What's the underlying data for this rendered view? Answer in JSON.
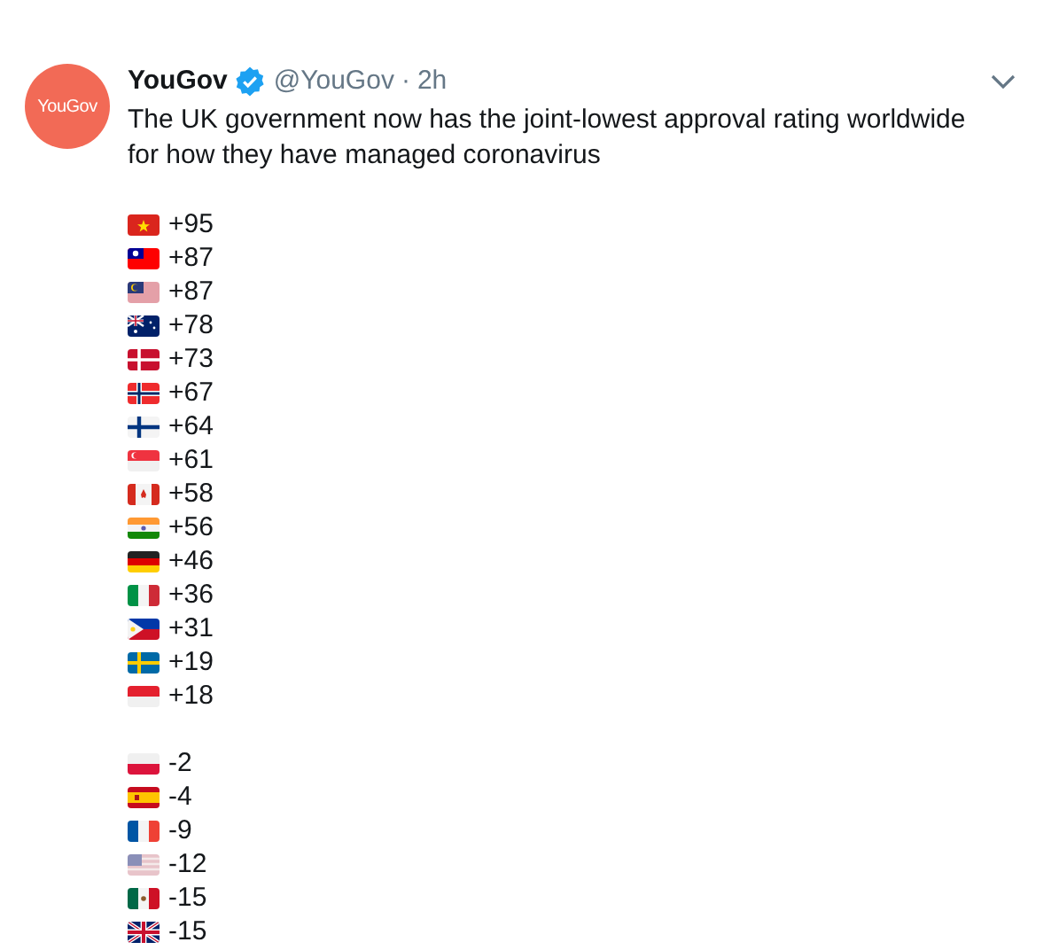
{
  "tweet": {
    "name": "YouGov",
    "handle": "@YouGov",
    "separator": "·",
    "time": "2h",
    "verified": true,
    "avatar_text": "YouGov",
    "text": "The UK government now has the joint-lowest approval rating worldwide for how they have managed coronavirus"
  },
  "groups": [
    {
      "rows": [
        {
          "kind": "vn",
          "value": "+95"
        },
        {
          "kind": "tw",
          "value": "+87"
        },
        {
          "kind": "my",
          "value": "+87"
        },
        {
          "kind": "au",
          "value": "+78"
        },
        {
          "kind": "dk",
          "value": "+73"
        },
        {
          "kind": "no",
          "value": "+67"
        },
        {
          "kind": "fi",
          "value": "+64"
        },
        {
          "kind": "sg",
          "value": "+61"
        },
        {
          "kind": "ca",
          "value": "+58"
        },
        {
          "kind": "in",
          "value": "+56"
        },
        {
          "kind": "de",
          "value": "+46"
        },
        {
          "kind": "it",
          "value": "+36"
        },
        {
          "kind": "ph",
          "value": "+31"
        },
        {
          "kind": "se",
          "value": "+19"
        },
        {
          "kind": "id",
          "value": "+18"
        }
      ]
    },
    {
      "rows": [
        {
          "kind": "pl",
          "value": "-2"
        },
        {
          "kind": "es",
          "value": "-4"
        },
        {
          "kind": "fr",
          "value": "-9"
        },
        {
          "kind": "us",
          "value": "-12"
        },
        {
          "kind": "mx",
          "value": "-15"
        },
        {
          "kind": "gb",
          "value": "-15"
        }
      ]
    }
  ]
}
